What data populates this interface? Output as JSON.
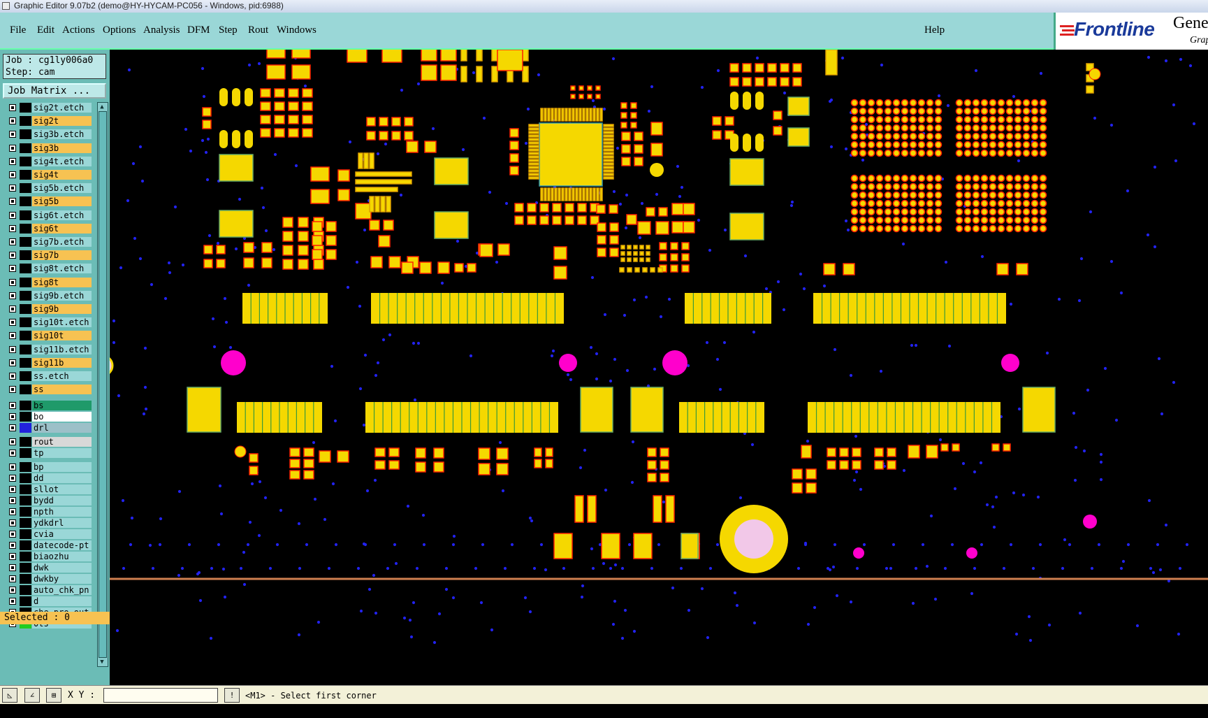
{
  "window": {
    "title": "Graphic Editor 9.07b2 (demo@HY-HYCAM-PC056 - Windows, pid:6988)"
  },
  "menu": {
    "items": [
      "File",
      "Edit",
      "Actions",
      "Options",
      "Analysis",
      "DFM",
      "Step",
      "Rout",
      "Windows"
    ],
    "help": "Help"
  },
  "logo": {
    "brand": "Frontline",
    "gene": "Gene",
    "grap": "Grap"
  },
  "job": {
    "line1": "Job : cg1ly006a0",
    "line2": "Step: cam",
    "matrix_button": "Job Matrix ..."
  },
  "layers": [
    {
      "name": "sig2t.etch",
      "color": "#9ad7d7"
    },
    {
      "name": "sig2t",
      "color": "#f7c252"
    },
    {
      "name": "sig3b.etch",
      "color": "#9ad7d7"
    },
    {
      "name": "sig3b",
      "color": "#f7c252"
    },
    {
      "name": "sig4t.etch",
      "color": "#9ad7d7"
    },
    {
      "name": "sig4t",
      "color": "#f7c252"
    },
    {
      "name": "sig5b.etch",
      "color": "#9ad7d7"
    },
    {
      "name": "sig5b",
      "color": "#f7c252"
    },
    {
      "name": "sig6t.etch",
      "color": "#9ad7d7"
    },
    {
      "name": "sig6t",
      "color": "#f7c252"
    },
    {
      "name": "sig7b.etch",
      "color": "#9ad7d7"
    },
    {
      "name": "sig7b",
      "color": "#f7c252"
    },
    {
      "name": "sig8t.etch",
      "color": "#9ad7d7"
    },
    {
      "name": "sig8t",
      "color": "#f7c252"
    },
    {
      "name": "sig9b.etch",
      "color": "#9ad7d7"
    },
    {
      "name": "sig9b",
      "color": "#f7c252"
    },
    {
      "name": "sig10t.etch",
      "color": "#9ad7d7"
    },
    {
      "name": "sig10t",
      "color": "#f7c252"
    },
    {
      "name": "sig11b.etch",
      "color": "#9ad7d7"
    },
    {
      "name": "sig11b",
      "color": "#f7c252"
    },
    {
      "name": "ss.etch",
      "color": "#9ad7d7"
    },
    {
      "name": "ss",
      "color": "#f7c252"
    },
    {
      "name": "bs",
      "color": "#1f9a6a"
    },
    {
      "name": "bo",
      "color": "#ffffff"
    },
    {
      "name": "drl",
      "color": "#9cc0c8",
      "swatch": "#2222dd"
    },
    {
      "name": "rout",
      "color": "#d8d8d8"
    },
    {
      "name": "tp",
      "color": "#9ad7d7"
    },
    {
      "name": "bp",
      "color": "#9ad7d7"
    },
    {
      "name": "dd",
      "color": "#9ad7d7"
    },
    {
      "name": "sllot",
      "color": "#9ad7d7"
    },
    {
      "name": "bydd",
      "color": "#9ad7d7"
    },
    {
      "name": "npth",
      "color": "#9ad7d7"
    },
    {
      "name": "ydkdrl",
      "color": "#9ad7d7"
    },
    {
      "name": "cvia",
      "color": "#9ad7d7"
    },
    {
      "name": "datecode-pt",
      "color": "#9ad7d7"
    },
    {
      "name": "biaozhu",
      "color": "#9ad7d7"
    },
    {
      "name": "dwk",
      "color": "#9ad7d7"
    },
    {
      "name": "dwkby",
      "color": "#9ad7d7"
    },
    {
      "name": "auto_chk_pn",
      "color": "#9ad7d7"
    },
    {
      "name": "d",
      "color": "#9ad7d7"
    },
    {
      "name": "che-pro-out",
      "color": "#9ad7d7"
    },
    {
      "name": "0ts",
      "color": "#9ad7d7",
      "swatch": "#22cc22"
    }
  ],
  "selected": "Selected : 0",
  "bottom": {
    "xy_label": "X Y :",
    "xy_value": "",
    "status": "<M1> - Select first corner"
  },
  "colors": {
    "pad": "#f5d800",
    "pad_outline": "#ff2200",
    "via": "#2222ee",
    "drill": "#ff00cc",
    "board_edge": "#d08050"
  }
}
